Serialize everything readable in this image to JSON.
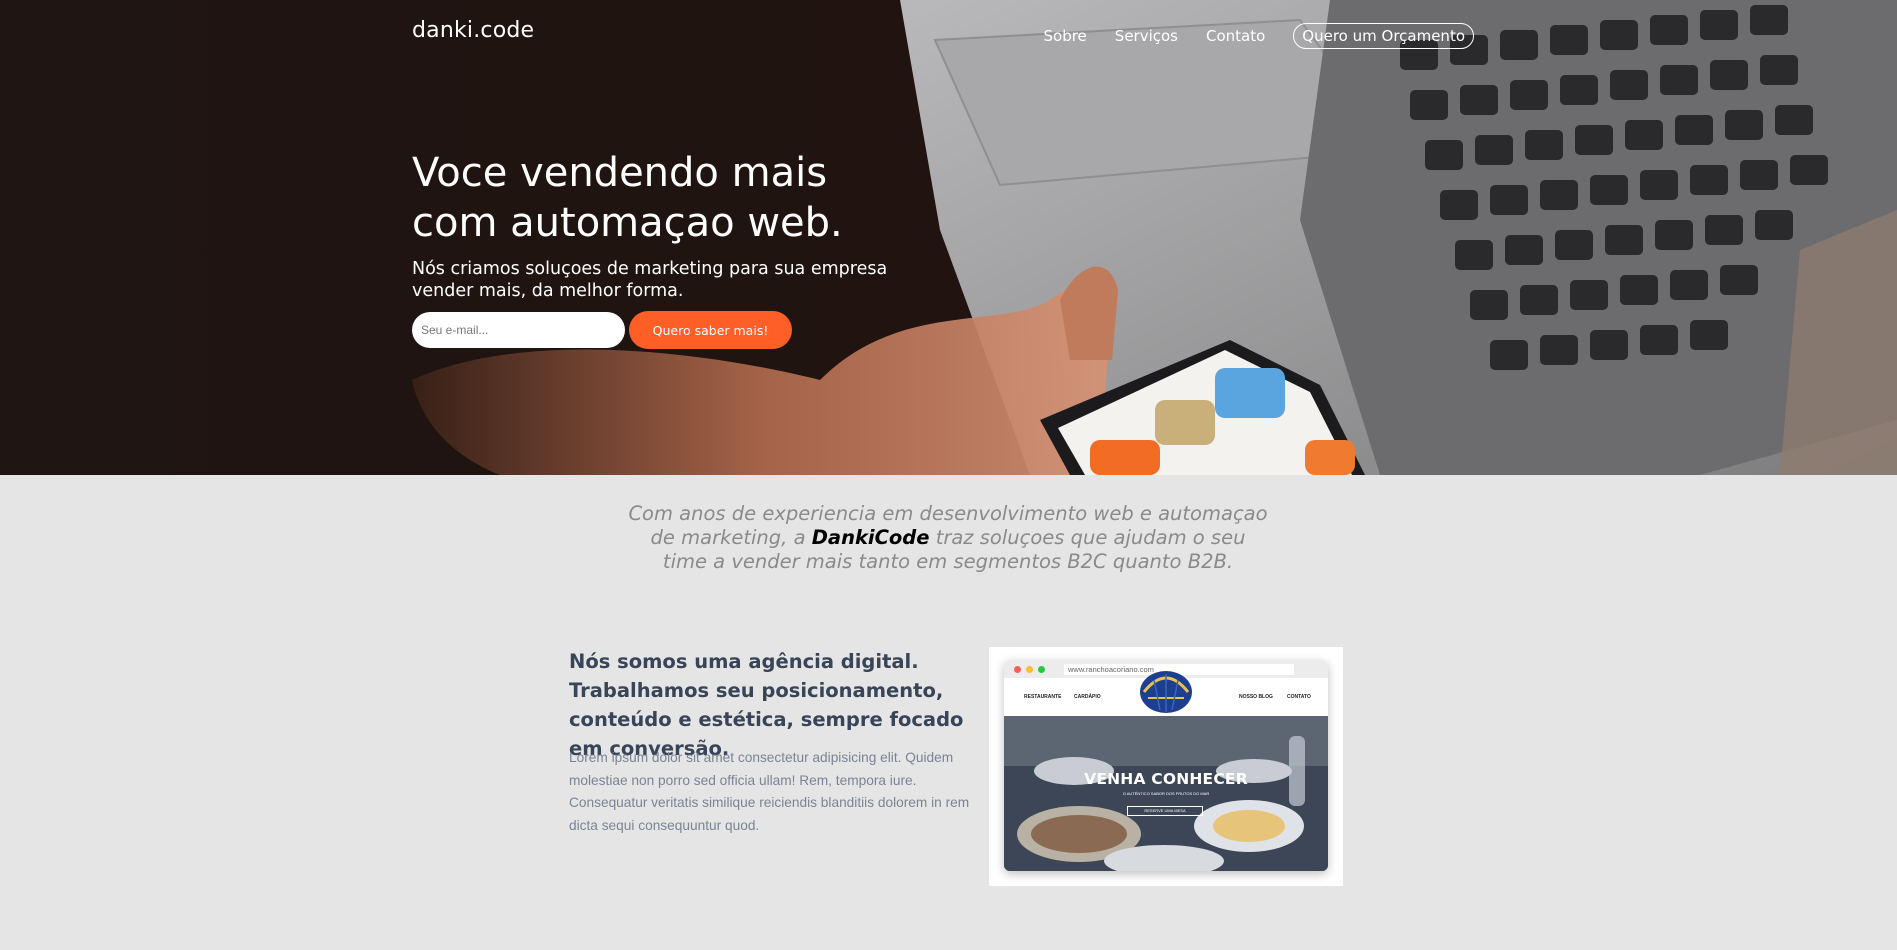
{
  "header": {
    "logo": "danki.code",
    "nav": [
      "Sobre",
      "Serviços",
      "Contato"
    ],
    "quote_button": "Quero um Orçamento"
  },
  "hero": {
    "title_line1": "Voce vendendo mais",
    "title_line2": "com automaçao web.",
    "subtitle": "Nós criamos soluçoes de marketing para sua empresa vender mais, da melhor forma.",
    "email_placeholder": "Seu e-mail...",
    "cta_button": "Quero saber mais!"
  },
  "intro": {
    "text_before": "Com anos de experiencia em desenvolvimento web e automaçao de marketing, a ",
    "brand": "DankiCode",
    "text_after": " traz soluçoes que ajudam o seu time a vender mais tanto em segmentos B2C quanto B2B."
  },
  "agency": {
    "heading": "Nós somos uma agência digital. Trabalhamos seu posicionamento, conteúdo e estética, sempre focado em conversão.",
    "body": "Lorem ipsum dolor sit amet consectetur adipisicing elit. Quidem molestiae non porro sed officia ullam! Rem, tempora iure. Consequatur veritatis similique reiciendis blanditiis dolorem in rem dicta sequi consequuntur quod."
  },
  "preview": {
    "url": "www.ranchoacoriano.com",
    "nav_left": [
      "RESTAURANTE",
      "CARDÁPIO"
    ],
    "nav_right": [
      "NOSSO BLOG",
      "CONTATO"
    ],
    "hero_title": "VENHA CONHECER",
    "hero_sub": "O AUTÊNTICO SABOR DOS FRUTOS DO MAR",
    "hero_button": "RESERVE UMA MESA"
  },
  "colors": {
    "accent": "#ff5e26",
    "hero_dark": "#21130f",
    "page_bg": "#e5e5e5",
    "heading": "#384457",
    "body_text": "#7b8494"
  }
}
